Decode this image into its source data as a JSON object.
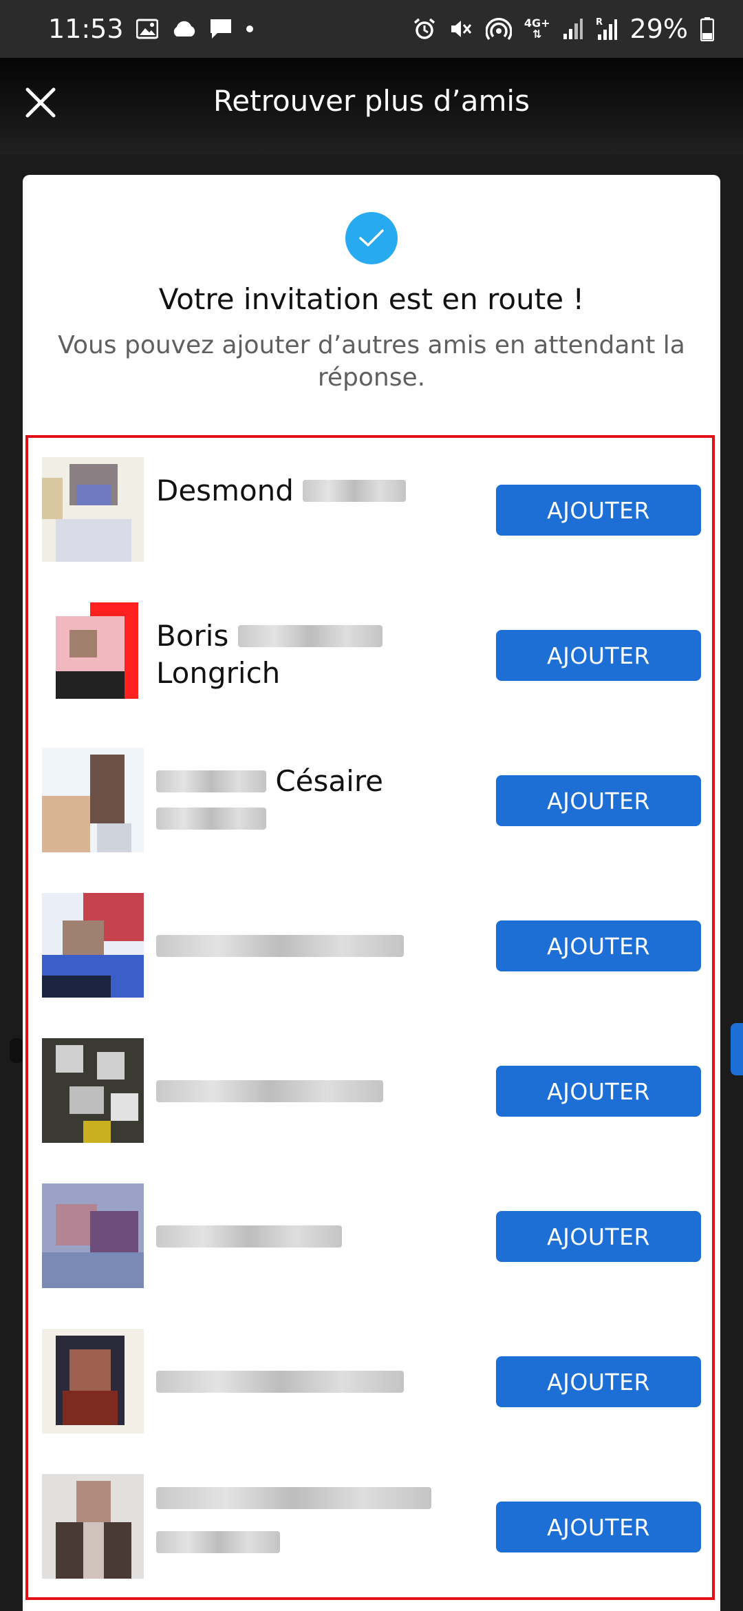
{
  "status_bar": {
    "time": "11:53",
    "battery": "29%",
    "network": "4G+",
    "left_icons": [
      "gallery-icon",
      "cloud-icon",
      "message-icon",
      "dot-icon"
    ],
    "right_icons": [
      "alarm-icon",
      "mute-icon",
      "hotspot-icon",
      "network-4g-icon",
      "signal-icon",
      "signal-roaming-icon",
      "battery-icon"
    ]
  },
  "app_bar": {
    "title": "Retrouver plus d’amis",
    "close_icon": "close-icon"
  },
  "confirmation": {
    "icon": "check-circle-icon",
    "title": "Votre invitation est en route !",
    "subtitle": "Vous pouvez ajouter d’autres amis en attendant la réponse."
  },
  "friends": [
    {
      "name_visible": "Desmond",
      "blurred": "after"
    },
    {
      "name_visible": "Boris",
      "name_visible_2": "Longrich",
      "blurred": "middle"
    },
    {
      "name_visible": "Césaire",
      "blurred": "around"
    },
    {
      "name_visible": "",
      "blurred": "full"
    },
    {
      "name_visible": "",
      "blurred": "full"
    },
    {
      "name_visible": "",
      "blurred": "full"
    },
    {
      "name_visible": "",
      "blurred": "full"
    },
    {
      "name_visible": "",
      "blurred": "full-two-lines"
    }
  ],
  "add_button_label": "AJOUTER",
  "colors": {
    "accent_blue": "#1d6fd6",
    "check_blue": "#27aaf0",
    "highlight_red": "#e1111a"
  }
}
